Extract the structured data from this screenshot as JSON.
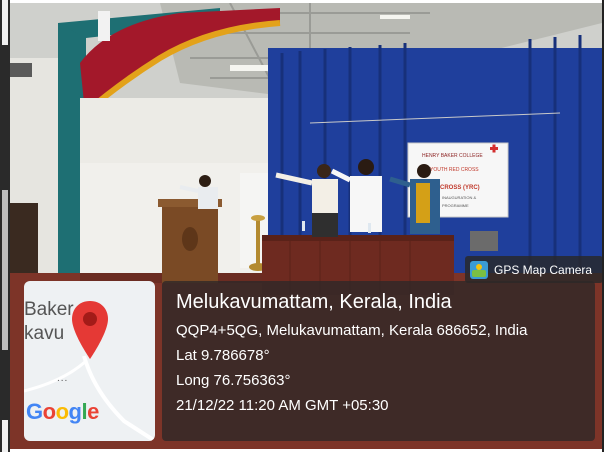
{
  "gps_badge": {
    "label": "GPS Map Camera",
    "icon": "gps-map-camera-icon"
  },
  "location": {
    "title": "Melukavumattam, Kerala, India",
    "address": "QQP4+5QG, Melukavumattam, Kerala 686652, India",
    "lat": "Lat 9.786678°",
    "long": "Long 76.756363°",
    "datetime": "21/12/22 11:20 AM GMT +05:30"
  },
  "map": {
    "town_line1": "Baker",
    "town_line2": "kavu",
    "dots": "...",
    "google_letters": [
      "G",
      "o",
      "o",
      "g",
      "l",
      "e"
    ],
    "google_colors": [
      "#4285F4",
      "#EA4335",
      "#FBBC05",
      "#4285F4",
      "#34A853",
      "#EA4335"
    ],
    "pin_color": "#e53935"
  },
  "banner": {
    "line1": "HENRY BAKER COLLEGE",
    "line2": "YOUTH RED CROSS",
    "line3": "CROSS (YRC)",
    "line4": "INAUGURATION &",
    "line5": "PROGRAMME"
  },
  "colors": {
    "curtain_blue": "#1f3f9c",
    "curtain_red": "#a3182a",
    "wall": "#e9e8e3",
    "floor": "#8a3a2e",
    "podium": "#7a4a25"
  }
}
